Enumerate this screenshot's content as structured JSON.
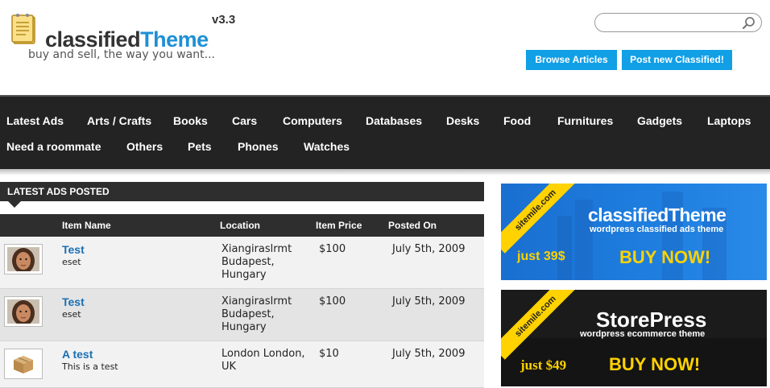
{
  "header": {
    "logo": {
      "word_main": "classified",
      "word_accent": "Theme",
      "version": "v3.3"
    },
    "tagline": "buy and sell, the way you want...",
    "search": {
      "placeholder": "",
      "value": ""
    },
    "buttons": {
      "browse": "Browse Articles",
      "post": "Post new Classified!"
    }
  },
  "nav": {
    "items": [
      "Latest Ads",
      "Arts / Crafts",
      "Books",
      "Cars",
      "Computers",
      "Databases",
      "Desks",
      "Food",
      "Furnitures",
      "Gadgets",
      "Laptops",
      "Need a roommate",
      "Others",
      "Pets",
      "Phones",
      "Watches"
    ]
  },
  "latest": {
    "title": "LATEST ADS POSTED",
    "columns": [
      "Item Name",
      "Location",
      "Item Price",
      "Posted On"
    ],
    "rows": [
      {
        "name": "Test",
        "desc": "eset",
        "location": "Xiangiraslrmt Budapest, Hungary",
        "price": "$100",
        "date": "July 5th, 2009",
        "thumb": "girl-photo"
      },
      {
        "name": "Test",
        "desc": "eset",
        "location": "Xiangiraslrmt Budapest, Hungary",
        "price": "$100",
        "date": "July 5th, 2009",
        "thumb": "girl-photo"
      },
      {
        "name": "A test",
        "desc": "This is a test",
        "location": "London London, UK",
        "price": "$10",
        "date": "July 5th, 2009",
        "thumb": "cardboard-box"
      }
    ]
  },
  "banners": [
    {
      "ribbon": "sitemile.com",
      "title": "classifiedTheme",
      "subtitle": "wordpress classified ads theme",
      "price": "just 39$",
      "cta": "BUY NOW!"
    },
    {
      "ribbon": "sitemile.com",
      "title": "StorePress",
      "subtitle": "wordpress ecommerce theme",
      "price": "just $49",
      "cta": "BUY NOW!"
    }
  ],
  "colors": {
    "accent": "#1e90d6",
    "button": "#119fe6",
    "nav_bg": "#232323",
    "link": "#1a6fb5",
    "cta_yellow": "#ffd200"
  }
}
